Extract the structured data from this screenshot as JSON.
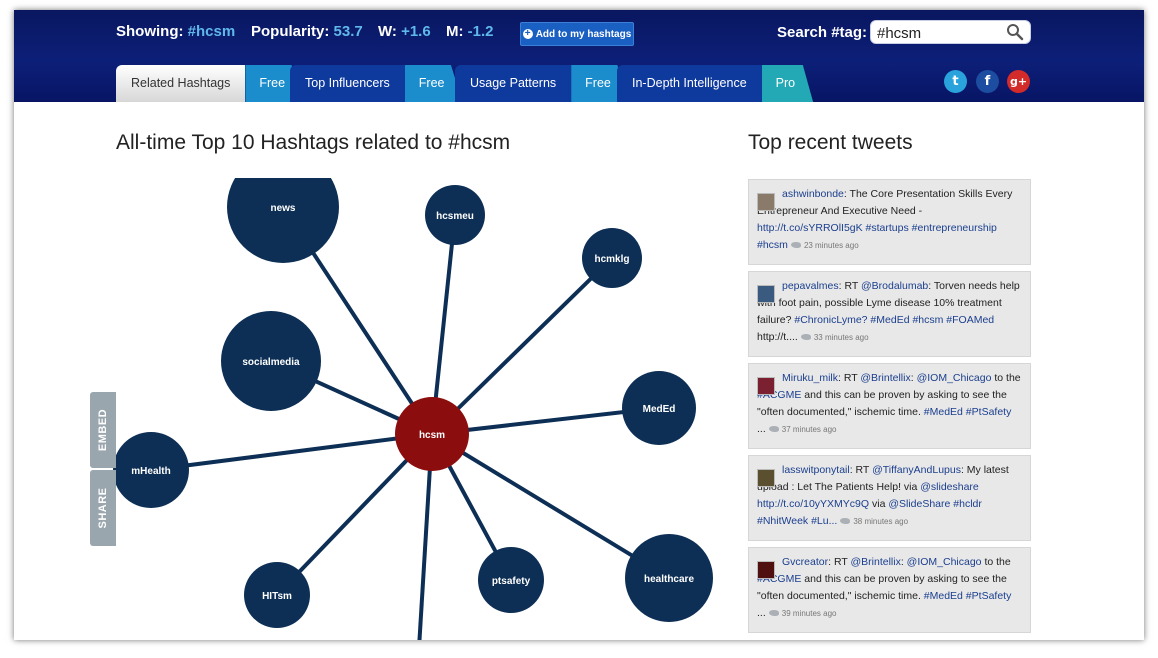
{
  "header": {
    "showing_label": "Showing:",
    "showing_value": "#hcsm",
    "popularity_label": "Popularity:",
    "popularity_value": "53.7",
    "w_label": "W:",
    "w_value": "+1.6",
    "m_label": "M:",
    "m_value": "-1.2",
    "add_button": "Add to my hashtags",
    "search_label": "Search #tag:",
    "search_value": "#hcsm"
  },
  "tabs": [
    {
      "label": "Related Hashtags",
      "badge": "Free"
    },
    {
      "label": "Top Influencers",
      "badge": "Free"
    },
    {
      "label": "Usage Patterns",
      "badge": "Free"
    },
    {
      "label": "In-Depth Intelligence",
      "badge": "Pro"
    }
  ],
  "social": {
    "twitter": "twitter-icon",
    "facebook": "facebook-icon",
    "google": "google-plus-icon"
  },
  "main": {
    "graph_title": "All-time Top 10 Hashtags related to #hcsm",
    "tweets_title": "Top recent tweets",
    "embed_label": "EMBED",
    "share_label": "SHARE"
  },
  "graph": {
    "center": "hcsm",
    "nodes": [
      "news",
      "hcsmeu",
      "hcmklg",
      "socialmedia",
      "MedEd",
      "mHealth",
      "HITsm",
      "ptsafety",
      "healthcare"
    ],
    "colors": {
      "center": "#8b0d0d",
      "node": "#0d2f55",
      "edge": "#0d2f55"
    }
  },
  "tweets": [
    {
      "user": "ashwinbonde",
      "text": ": The Core Presentation Skills Every Entrepreneur And Executive Need - ",
      "links": "http://t.co/sYRROlI5gK #startups #entrepreneurship #hcsm",
      "time": "23 minutes ago",
      "avatar": "#8a7a6a"
    },
    {
      "user": "pepavalmes",
      "text": ": RT ",
      "mention": "@Brodalumab",
      "text2": ": Torven needs help with foot pain, possible Lyme disease 10% treatment failure? ",
      "links": "#ChronicLyme? #MedEd #hcsm #FOAMed",
      "tail": " http://t....",
      "time": "33 minutes ago",
      "avatar": "#3a5a80"
    },
    {
      "user": "Miruku_milk",
      "text": ": RT ",
      "mention": "@Brintellix",
      "text2": ": ",
      "mention2": "@IOM_Chicago",
      "text3": " to the ",
      "links": "#ACGME",
      "text4": " and this can be proven by asking to see the \"often documented,\" ischemic time. ",
      "links2": "#MedEd #PtSafety",
      "tail": " ...",
      "time": "37 minutes ago",
      "avatar": "#7a2030"
    },
    {
      "user": "lasswitponytail",
      "text": ": RT ",
      "mention": "@TiffanyAndLupus",
      "text2": ": My latest upload : Let The Patients Help! via ",
      "mention2": "@slideshare",
      "text3": " ",
      "links": "http://t.co/10yYXMYc9Q",
      "text4": " via ",
      "links2": "@SlideShare #hcldr #NhitWeek #Lu...",
      "time": "38 minutes ago",
      "avatar": "#5a5030"
    },
    {
      "user": "Gvcreator",
      "text": ": RT ",
      "mention": "@Brintellix",
      "text2": ": ",
      "mention2": "@IOM_Chicago",
      "text3": " to the ",
      "links": "#ACGME",
      "text4": " and this can be proven by asking to see the \"often documented,\" ischemic time. ",
      "links2": "#MedEd #PtSafety",
      "tail": " ...",
      "time": "39 minutes ago",
      "avatar": "#501010"
    }
  ]
}
